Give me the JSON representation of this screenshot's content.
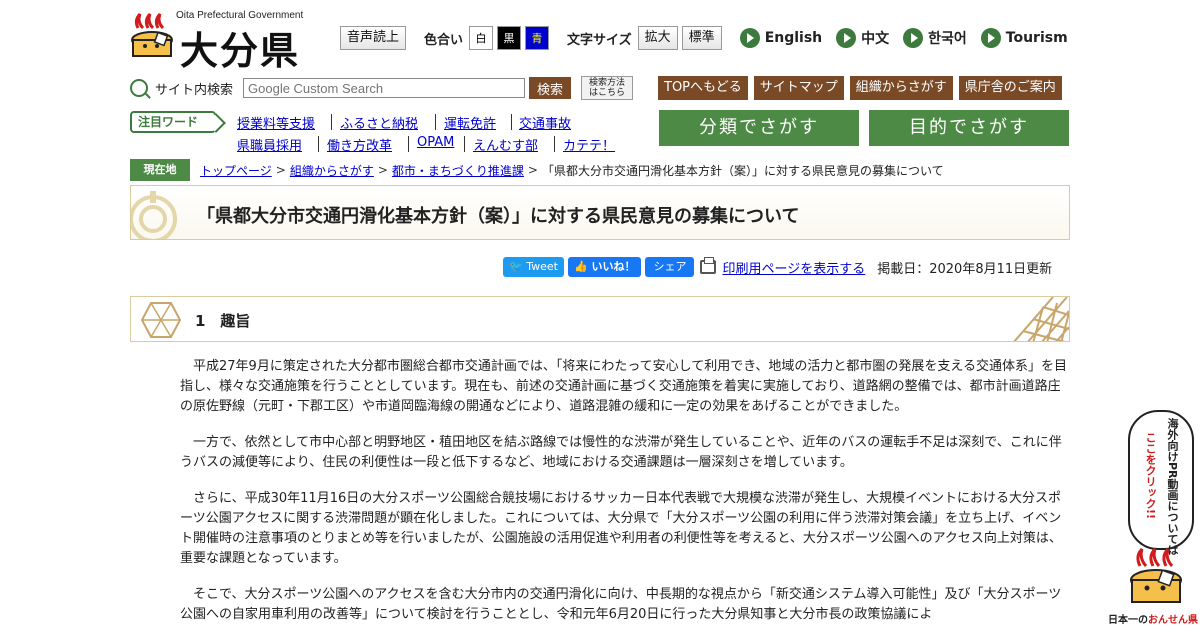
{
  "header": {
    "gov_label": "Oita Prefectural Government",
    "site_name": "大分県",
    "read_aloud": "音声読上",
    "color_label": "色合い",
    "colors": [
      {
        "label": "白",
        "bg": "#ffffff",
        "fg": "#000000"
      },
      {
        "label": "黒",
        "bg": "#000000",
        "fg": "#ffffff"
      },
      {
        "label": "青",
        "bg": "#0000cc",
        "fg": "#ffff00"
      }
    ],
    "font_size_label": "文字サイズ",
    "enlarge": "拡大",
    "standard": "標準",
    "languages": [
      "English",
      "中文",
      "한국어",
      "Tourism"
    ]
  },
  "search": {
    "label": "サイト内検索",
    "placeholder": "Google Custom Search",
    "button": "検索",
    "howto": "検索方法はこちら"
  },
  "quick_links": [
    "TOPへもどる",
    "サイトマップ",
    "組織からさがす",
    "県庁舎のご案内"
  ],
  "keywords": {
    "label": "注目ワード",
    "items": [
      "授業料等支援",
      "ふるさと納税",
      "運転免許",
      "交通事故",
      "県職員採用",
      "働き方改革",
      "OPAM",
      "えんむす部",
      "カテテ！"
    ]
  },
  "big_buttons": [
    "分類でさがす",
    "目的でさがす"
  ],
  "breadcrumb": {
    "label": "現在地",
    "links": [
      "トップページ",
      "組織からさがす",
      "都市・まちづくり推進課"
    ],
    "current": "「県都大分市交通円滑化基本方針（案）」に対する県民意見の募集について"
  },
  "page_title": "「県都大分市交通円滑化基本方針（案）」に対する県民意見の募集について",
  "share": {
    "tweet": "Tweet",
    "like": "いいね！",
    "share": "シェア",
    "print": "印刷用ページを表示する",
    "posted": "掲載日：2020年8月11日更新"
  },
  "section": {
    "heading": "1　趣旨",
    "paragraphs": [
      "平成27年9月に策定された大分都市圏総合都市交通計画では、「将来にわたって安心して利用でき、地域の活力と都市圏の発展を支える交通体系」を目指し、様々な交通施策を行うこととしています。現在も、前述の交通計画に基づく交通施策を着実に実施しており、道路網の整備では、都市計画道路庄の原佐野線（元町・下郡工区）や市道岡臨海線の開通などにより、道路混雑の緩和に一定の効果をあげることができました。",
      "一方で、依然として市中心部と明野地区・稙田地区を結ぶ路線では慢性的な渋滞が発生していることや、近年のバスの運転手不足は深刻で、これに伴うバスの減便等により、住民の利便性は一段と低下するなど、地域における交通課題は一層深刻さを増しています。",
      "さらに、平成30年11月16日の大分スポーツ公園総合競技場におけるサッカー日本代表戦で大規模な渋滞が発生し、大規模イベントにおける大分スポーツ公園アクセスに関する渋滞問題が顕在化しました。これについては、大分県で「大分スポーツ公園の利用に伴う渋滞対策会議」を立ち上げ、イベント開催時の注意事項のとりまとめ等を行いましたが、公園施設の活用促進や利用者の利便性等を考えると、大分スポーツ公園へのアクセス向上対策は、重要な課題となっています。",
      "そこで、大分スポーツ公園へのアクセスを含む大分市内の交通円滑化に向け、中長期的な視点から「新交通システム導入可能性」及び「大分スポーツ公園への自家用車利用の改善等」について検討を行うこととし、令和元年6月20日に行った大分県知事と大分市長の政策協議によ"
    ]
  },
  "banner": {
    "text1": "海外向けPR動画については",
    "text2": "ここをクリック!!",
    "caption_prefix": "日本一の",
    "caption_highlight": "おんせん県"
  },
  "theme": {
    "green": "#4c8a45",
    "brown": "#7a4a26",
    "link": "#0000cc",
    "beige_border": "#d9cba0"
  }
}
